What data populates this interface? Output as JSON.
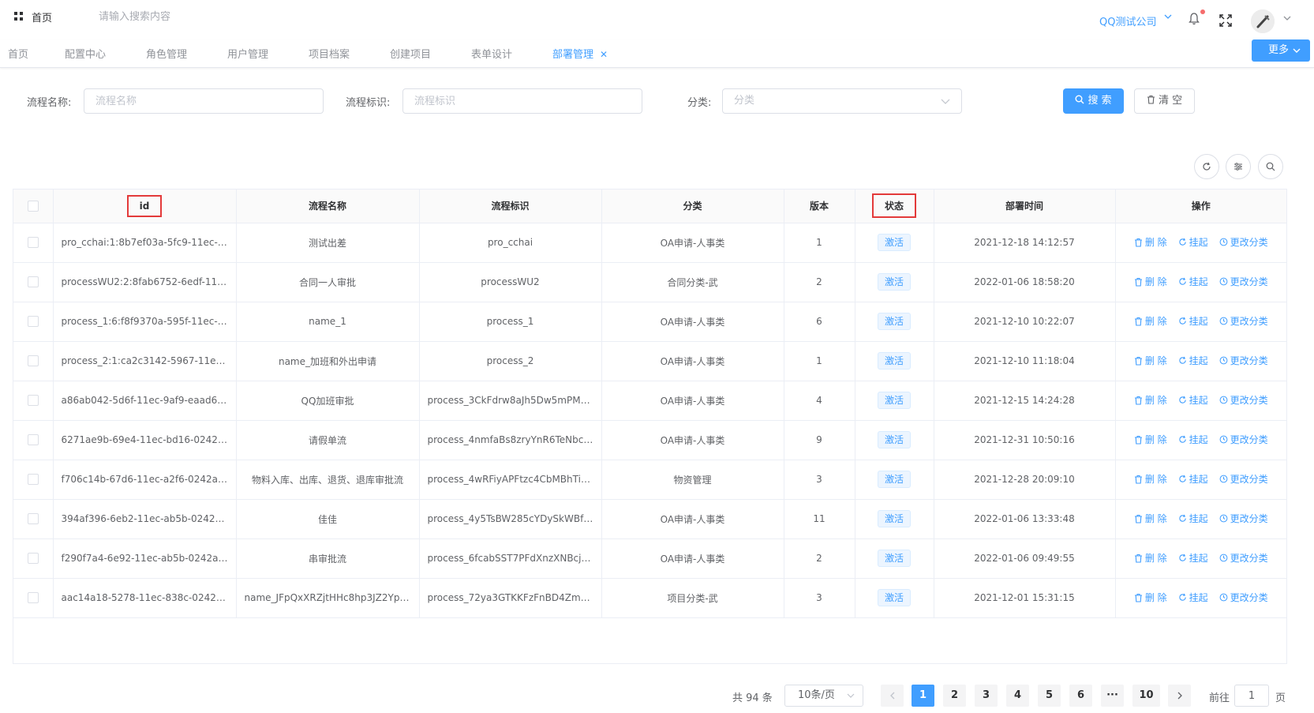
{
  "header": {
    "home_title": "首页",
    "search_placeholder": "请输入搜索内容",
    "company": "QQ测试公司"
  },
  "tabs": [
    {
      "label": "首页"
    },
    {
      "label": "配置中心"
    },
    {
      "label": "角色管理"
    },
    {
      "label": "用户管理"
    },
    {
      "label": "项目档案"
    },
    {
      "label": "创建项目"
    },
    {
      "label": "表单设计"
    },
    {
      "label": "部署管理",
      "active": true
    }
  ],
  "more_label": "更多",
  "filters": {
    "name_label": "流程名称:",
    "name_placeholder": "流程名称",
    "key_label": "流程标识:",
    "key_placeholder": "流程标识",
    "category_label": "分类:",
    "category_placeholder": "分类",
    "search_label": "搜 索",
    "clear_label": "清 空"
  },
  "table": {
    "columns": [
      "id",
      "流程名称",
      "流程标识",
      "分类",
      "版本",
      "状态",
      "部署时间",
      "操作"
    ],
    "op_labels": {
      "delete": "删 除",
      "suspend": "挂起",
      "change_category": "更改分类"
    },
    "rows": [
      {
        "id": "pro_cchai:1:8b7ef03a-5fc9-11ec-9...",
        "name": "测试出差",
        "key": "pro_cchai",
        "category": "OA申请-人事类",
        "version": "1",
        "status": "激活",
        "time": "2021-12-18 14:12:57"
      },
      {
        "id": "processWU2:2:8fab6752-6edf-11e...",
        "name": "合同一人审批",
        "key": "processWU2",
        "category": "合同分类-武",
        "version": "2",
        "status": "激活",
        "time": "2022-01-06 18:58:20"
      },
      {
        "id": "process_1:6:f8f9370a-595f-11ec-9c...",
        "name": "name_1",
        "key": "process_1",
        "category": "OA申请-人事类",
        "version": "6",
        "status": "激活",
        "time": "2021-12-10 10:22:07"
      },
      {
        "id": "process_2:1:ca2c3142-5967-11ec-...",
        "name": "name_加班和外出申请",
        "key": "process_2",
        "category": "OA申请-人事类",
        "version": "1",
        "status": "激活",
        "time": "2021-12-10 11:18:04"
      },
      {
        "id": "a86ab042-5d6f-11ec-9af9-eaad66...",
        "name": "QQ加班审批",
        "key": "process_3CkFdrw8aJh5Dw5mPME...",
        "category": "OA申请-人事类",
        "version": "4",
        "status": "激活",
        "time": "2021-12-15 14:24:28"
      },
      {
        "id": "6271ae9b-69e4-11ec-bd16-0242a...",
        "name": "请假单流",
        "key": "process_4nmfaBs8zryYnR6TeNbck...",
        "category": "OA申请-人事类",
        "version": "9",
        "status": "激活",
        "time": "2021-12-31 10:50:16"
      },
      {
        "id": "f706c14b-67d6-11ec-a2f6-0242ac...",
        "name": "物料入库、出库、退货、退库审批流",
        "key": "process_4wRFiyAPFtzc4CbMBhTiz...",
        "category": "物资管理",
        "version": "3",
        "status": "激活",
        "time": "2021-12-28 20:09:10"
      },
      {
        "id": "394af396-6eb2-11ec-ab5b-0242ac...",
        "name": "佳佳",
        "key": "process_4y5TsBW285cYDySkWBfd...",
        "category": "OA申请-人事类",
        "version": "11",
        "status": "激活",
        "time": "2022-01-06 13:33:48"
      },
      {
        "id": "f290f7a4-6e92-11ec-ab5b-0242ac...",
        "name": "串审批流",
        "key": "process_6fcabSST7PFdXnzXNBcj68...",
        "category": "OA申请-人事类",
        "version": "2",
        "status": "激活",
        "time": "2022-01-06 09:49:55"
      },
      {
        "id": "aac14a18-5278-11ec-838c-0242ac...",
        "name": "name_JFpQxXRZjtHHc8hp3JZ2Ypx...",
        "key": "process_72ya3GTKKFzFnBD4ZmbA...",
        "category": "项目分类-武",
        "version": "3",
        "status": "激活",
        "time": "2021-12-01 15:31:15"
      }
    ]
  },
  "pagination": {
    "total_text": "共 94 条",
    "page_size": "10条/页",
    "pages": [
      "1",
      "2",
      "3",
      "4",
      "5",
      "6",
      "···",
      "10"
    ],
    "current": "1",
    "goto_label": "前往",
    "goto_value": "1",
    "goto_suffix": "页"
  },
  "colors": {
    "accent": "#409eff",
    "highlight": "#e33a3a"
  }
}
